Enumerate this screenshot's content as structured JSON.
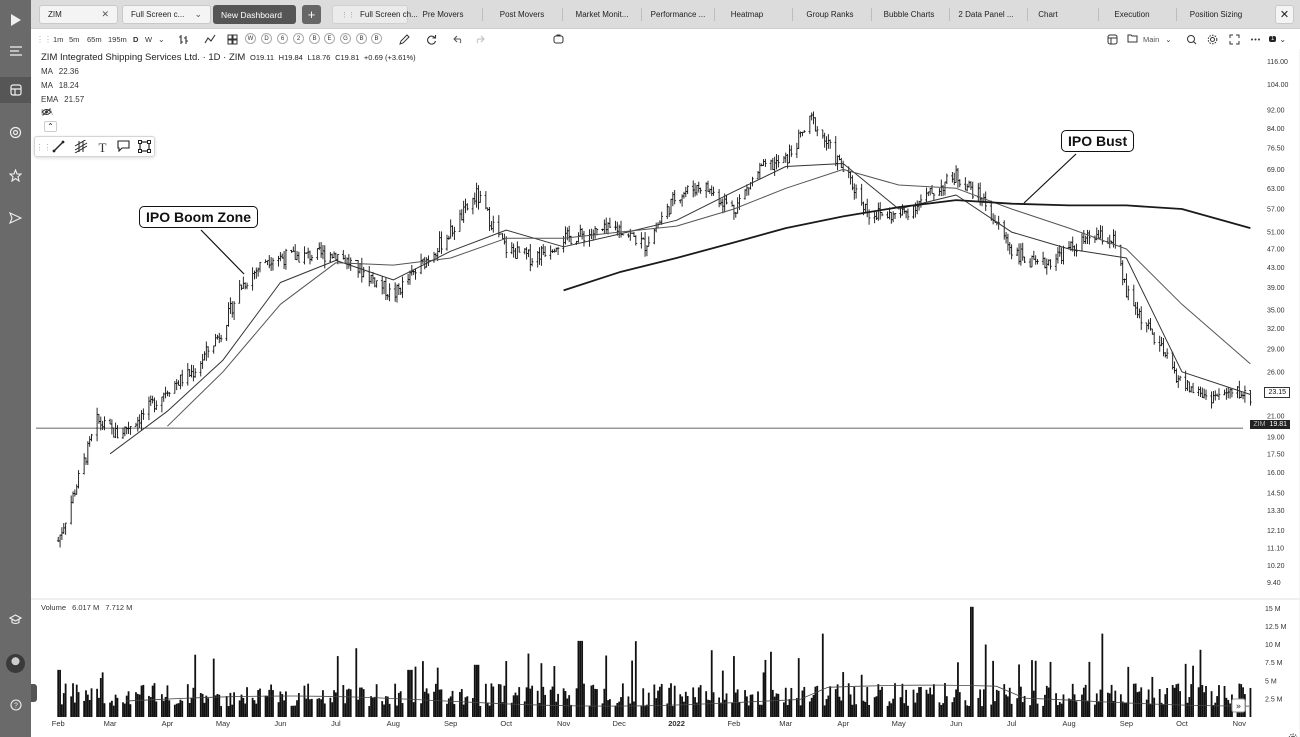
{
  "sidebar": {
    "icons": [
      "play-logo-icon",
      "menu-icon",
      "layout-icon",
      "radar-icon",
      "star-icon",
      "send-icon",
      "education-icon",
      "help-icon"
    ]
  },
  "tabs": {
    "symbol": "ZIM",
    "dashboard": "Full Screen c...",
    "new_dashboard": "New Dashboard",
    "plus": "+",
    "items": [
      "Full Screen ch...",
      "Pre Movers",
      "Post Movers",
      "Market Monit...",
      "Performance ...",
      "Heatmap",
      "Group Ranks",
      "Bubble Charts",
      "2 Data Panel ...",
      "Chart",
      "Execution",
      "Position Sizing"
    ]
  },
  "toolbar": {
    "intervals": [
      "1m",
      "5m",
      "65m",
      "195m",
      "D",
      "W"
    ],
    "quick_periods": [
      "W",
      "D",
      "6",
      "2",
      "B",
      "E",
      "G",
      "B",
      "B"
    ],
    "layout_label": "Main",
    "count_badge": "1"
  },
  "legend": {
    "title": "ZIM Integrated Shipping Services Ltd. · 1D · ZIM",
    "open": "O19.11",
    "high": "H19.84",
    "low": "L18.76",
    "close": "C19.81",
    "change": "+0.69 (+3.61%)",
    "ma1_label": "MA",
    "ma1_value": "22.36",
    "ma2_label": "MA",
    "ma2_value": "18.24",
    "ema_label": "EMA",
    "ema_value": "21.57",
    "ma_hidden_label": "MA"
  },
  "annotations": {
    "boom": "IPO Boom Zone",
    "bust": "IPO Bust"
  },
  "price_tags": {
    "last": "23.15",
    "symbol_tag": "ZIM",
    "current": "19.81"
  },
  "volume": {
    "label": "Volume",
    "value1": "6.017 M",
    "value2": "7.712 M"
  },
  "colors": {
    "sidebar": "#6a6a6a",
    "tabbar": "#dcdcdc",
    "candles": "#111111",
    "ma_line": "#444444",
    "current_line": "#222222"
  },
  "chart_data": {
    "type": "ohlc",
    "log_scale": true,
    "y_ticks": [
      "116.00",
      "104.00",
      "92.00",
      "84.00",
      "76.50",
      "69.00",
      "63.00",
      "57.00",
      "51.00",
      "47.00",
      "43.00",
      "39.00",
      "35.00",
      "32.00",
      "29.00",
      "26.00",
      "21.00",
      "19.00",
      "17.50",
      "16.00",
      "14.50",
      "13.30",
      "12.10",
      "11.10",
      "10.20",
      "9.40"
    ],
    "y_tick_values": [
      116,
      104,
      92,
      84,
      76.5,
      69,
      63,
      57,
      51,
      47,
      43,
      39,
      35,
      32,
      29,
      26,
      21,
      19,
      17.5,
      16,
      14.5,
      13.3,
      12.1,
      11.1,
      10.2,
      9.4
    ],
    "ylim": [
      8.9,
      121
    ],
    "x_labels": [
      "Feb",
      "Mar",
      "Apr",
      "May",
      "Jun",
      "Jul",
      "Aug",
      "Sep",
      "Oct",
      "Nov",
      "Dec",
      "2022",
      "Feb",
      "Mar",
      "Apr",
      "May",
      "Jun",
      "Jul",
      "Aug",
      "Sep",
      "Oct",
      "Nov"
    ],
    "x_label_dates": [
      "2021-02-01",
      "2021-03-01",
      "2021-04-01",
      "2021-05-01",
      "2021-06-01",
      "2021-07-01",
      "2021-08-01",
      "2021-09-01",
      "2021-10-01",
      "2021-11-01",
      "2021-12-01",
      "2022-01-01",
      "2022-02-01",
      "2022-03-01",
      "2022-04-01",
      "2022-05-01",
      "2022-06-01",
      "2022-07-01",
      "2022-08-01",
      "2022-09-01",
      "2022-10-01",
      "2022-11-01"
    ],
    "price_path": [
      [
        "2021-02-01",
        11.5
      ],
      [
        "2021-02-12",
        15.5
      ],
      [
        "2021-02-22",
        20.5
      ],
      [
        "2021-03-05",
        19.2
      ],
      [
        "2021-03-18",
        21.0
      ],
      [
        "2021-04-01",
        24.0
      ],
      [
        "2021-04-15",
        26.0
      ],
      [
        "2021-05-01",
        32.0
      ],
      [
        "2021-05-10",
        39.0
      ],
      [
        "2021-05-25",
        45.0
      ],
      [
        "2021-06-15",
        45.5
      ],
      [
        "2021-07-01",
        46.0
      ],
      [
        "2021-07-20",
        41.0
      ],
      [
        "2021-08-01",
        37.5
      ],
      [
        "2021-08-15",
        43.0
      ],
      [
        "2021-09-01",
        51.0
      ],
      [
        "2021-09-15",
        61.0
      ],
      [
        "2021-10-01",
        47.0
      ],
      [
        "2021-10-15",
        45.0
      ],
      [
        "2021-11-01",
        49.5
      ],
      [
        "2021-11-15",
        50.5
      ],
      [
        "2021-12-01",
        52.0
      ],
      [
        "2021-12-15",
        48.0
      ],
      [
        "2022-01-01",
        61.0
      ],
      [
        "2022-01-15",
        64.0
      ],
      [
        "2022-02-01",
        57.0
      ],
      [
        "2022-02-15",
        69.0
      ],
      [
        "2022-03-01",
        72.0
      ],
      [
        "2022-03-15",
        88.0
      ],
      [
        "2022-04-01",
        69.0
      ],
      [
        "2022-04-15",
        56.0
      ],
      [
        "2022-05-01",
        55.0
      ],
      [
        "2022-05-15",
        60.0
      ],
      [
        "2022-06-01",
        67.0
      ],
      [
        "2022-06-15",
        60.0
      ],
      [
        "2022-07-01",
        47.0
      ],
      [
        "2022-07-15",
        43.0
      ],
      [
        "2022-08-01",
        47.0
      ],
      [
        "2022-08-15",
        50.0
      ],
      [
        "2022-08-25",
        49.0
      ],
      [
        "2022-09-01",
        38.0
      ],
      [
        "2022-09-15",
        31.0
      ],
      [
        "2022-10-01",
        24.5
      ],
      [
        "2022-10-15",
        23.0
      ],
      [
        "2022-11-01",
        23.5
      ],
      [
        "2022-11-07",
        23.0
      ]
    ],
    "ma_short": [
      [
        "2021-03-01",
        17.5
      ],
      [
        "2021-04-01",
        21.5
      ],
      [
        "2021-05-01",
        27.5
      ],
      [
        "2021-06-01",
        40.0
      ],
      [
        "2021-07-01",
        44.5
      ],
      [
        "2021-08-01",
        40.5
      ],
      [
        "2021-09-01",
        46.5
      ],
      [
        "2021-10-01",
        51.5
      ],
      [
        "2021-11-01",
        47.5
      ],
      [
        "2021-12-01",
        50.5
      ],
      [
        "2022-01-01",
        54.0
      ],
      [
        "2022-02-01",
        62.0
      ],
      [
        "2022-03-01",
        70.0
      ],
      [
        "2022-04-01",
        71.0
      ],
      [
        "2022-05-01",
        57.0
      ],
      [
        "2022-06-01",
        61.0
      ],
      [
        "2022-07-01",
        51.0
      ],
      [
        "2022-08-01",
        47.0
      ],
      [
        "2022-09-01",
        45.0
      ],
      [
        "2022-10-01",
        26.0
      ],
      [
        "2022-11-07",
        23.3
      ]
    ],
    "ma_mid": [
      [
        "2021-04-01",
        20.0
      ],
      [
        "2021-05-01",
        26.0
      ],
      [
        "2021-06-01",
        36.0
      ],
      [
        "2021-07-01",
        44.0
      ],
      [
        "2021-08-01",
        43.5
      ],
      [
        "2021-09-01",
        45.0
      ],
      [
        "2021-10-01",
        49.5
      ],
      [
        "2021-11-01",
        49.5
      ],
      [
        "2021-12-01",
        51.0
      ],
      [
        "2022-01-01",
        52.5
      ],
      [
        "2022-02-01",
        57.0
      ],
      [
        "2022-03-01",
        63.0
      ],
      [
        "2022-04-01",
        69.0
      ],
      [
        "2022-05-01",
        64.0
      ],
      [
        "2022-06-01",
        63.0
      ],
      [
        "2022-07-01",
        57.0
      ],
      [
        "2022-08-01",
        52.0
      ],
      [
        "2022-09-01",
        47.0
      ],
      [
        "2022-10-01",
        36.0
      ],
      [
        "2022-11-07",
        27.0
      ]
    ],
    "ma_long": [
      [
        "2021-11-01",
        38.5
      ],
      [
        "2021-12-01",
        42.0
      ],
      [
        "2022-01-01",
        45.0
      ],
      [
        "2022-02-01",
        48.5
      ],
      [
        "2022-03-01",
        52.0
      ],
      [
        "2022-04-01",
        55.0
      ],
      [
        "2022-05-01",
        57.5
      ],
      [
        "2022-06-01",
        59.5
      ],
      [
        "2022-07-01",
        58.5
      ],
      [
        "2022-08-01",
        58.0
      ],
      [
        "2022-09-01",
        58.0
      ],
      [
        "2022-10-01",
        57.0
      ],
      [
        "2022-11-07",
        52.0
      ]
    ],
    "current_price": 19.81,
    "volume_ticks": [
      "15 M",
      "12.5 M",
      "10 M",
      "7.5 M",
      "5 M",
      "2.5 M"
    ],
    "volume_tick_values": [
      15,
      12.5,
      10,
      7.5,
      5,
      2.5
    ],
    "volume_max": 16,
    "volume_spikes": [
      [
        "2021-02-01",
        6.5
      ],
      [
        "2021-08-10",
        6.5
      ],
      [
        "2021-09-15",
        7.2
      ],
      [
        "2021-11-10",
        10.5
      ],
      [
        "2022-02-20",
        9.0
      ],
      [
        "2022-03-20",
        11.5
      ],
      [
        "2022-06-10",
        15.2
      ],
      [
        "2022-06-18",
        10.0
      ],
      [
        "2022-08-20",
        11.5
      ]
    ]
  }
}
